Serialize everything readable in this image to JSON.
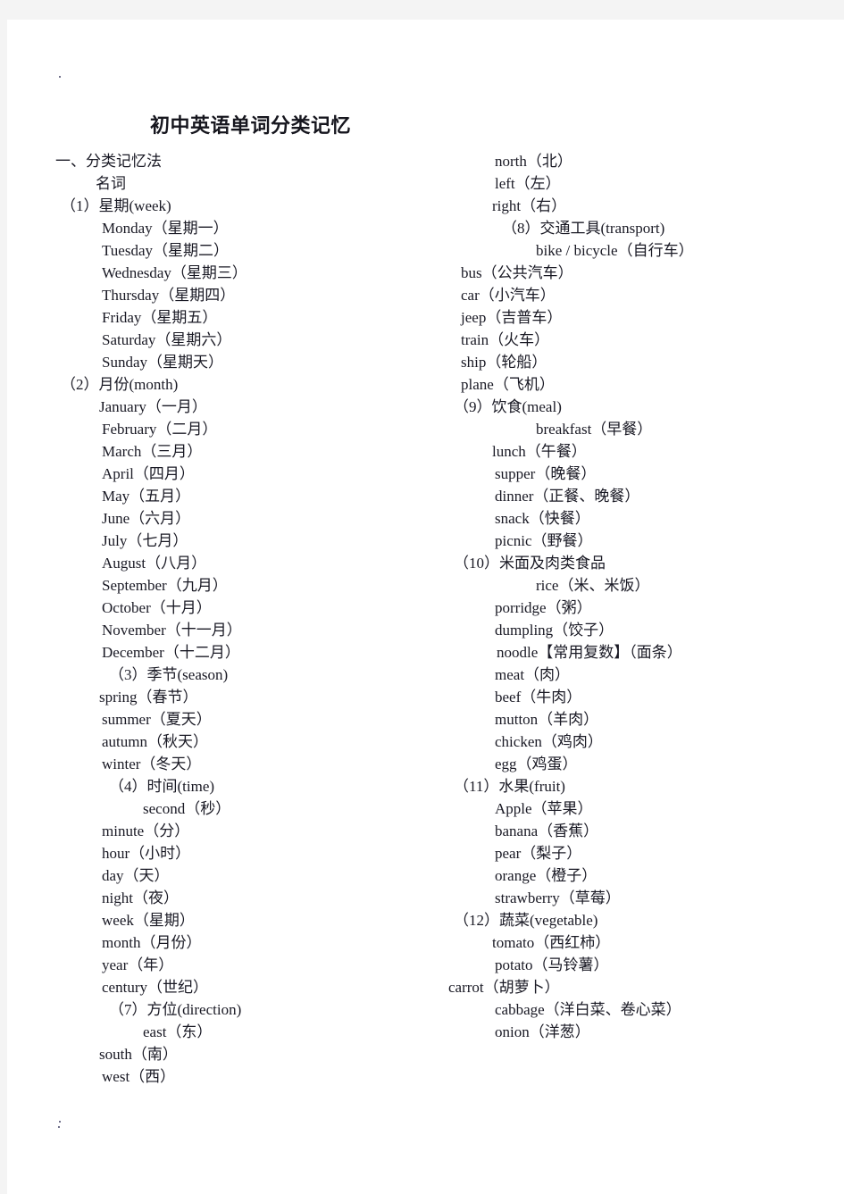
{
  "document": {
    "title": "初中英语单词分类记忆",
    "section_heading": "一、分类记忆法",
    "subheading": "名词"
  },
  "left_column": [
    {
      "text": "一、分类记忆法",
      "indent": "i0",
      "kind": "heading"
    },
    {
      "text": "名词",
      "indent": "i3",
      "kind": "subheading"
    },
    {
      "text": "（1）星期(week)",
      "indent": "i1",
      "kind": "group"
    },
    {
      "text": "Monday（星期一）",
      "indent": "i5",
      "kind": "entry"
    },
    {
      "text": "Tuesday（星期二）",
      "indent": "i5",
      "kind": "entry"
    },
    {
      "text": "Wednesday（星期三）",
      "indent": "i5",
      "kind": "entry"
    },
    {
      "text": "Thursday（星期四）",
      "indent": "i5",
      "kind": "entry"
    },
    {
      "text": "Friday（星期五）",
      "indent": "i5",
      "kind": "entry"
    },
    {
      "text": "Saturday（星期六）",
      "indent": "i5",
      "kind": "entry"
    },
    {
      "text": "Sunday（星期天）",
      "indent": "i5",
      "kind": "entry"
    },
    {
      "text": "（2）月份(month)",
      "indent": "i1",
      "kind": "group"
    },
    {
      "text": "January（一月）",
      "indent": "i4",
      "kind": "entry"
    },
    {
      "text": "February（二月）",
      "indent": "i5",
      "kind": "entry"
    },
    {
      "text": "March（三月）",
      "indent": "i5",
      "kind": "entry"
    },
    {
      "text": "April（四月）",
      "indent": "i5",
      "kind": "entry"
    },
    {
      "text": "May（五月）",
      "indent": "i5",
      "kind": "entry"
    },
    {
      "text": "June（六月）",
      "indent": "i5",
      "kind": "entry"
    },
    {
      "text": "July（七月）",
      "indent": "i5",
      "kind": "entry"
    },
    {
      "text": "August（八月）",
      "indent": "i5",
      "kind": "entry"
    },
    {
      "text": "September（九月）",
      "indent": "i5",
      "kind": "entry"
    },
    {
      "text": "October（十月）",
      "indent": "i5",
      "kind": "entry"
    },
    {
      "text": "November（十一月）",
      "indent": "i5",
      "kind": "entry"
    },
    {
      "text": "December（十二月）",
      "indent": "i5",
      "kind": "entry"
    },
    {
      "text": "（3）季节(season)",
      "indent": "i7",
      "kind": "group"
    },
    {
      "text": "spring（春节）",
      "indent": "i4",
      "kind": "entry"
    },
    {
      "text": "summer（夏天）",
      "indent": "i5",
      "kind": "entry"
    },
    {
      "text": "autumn（秋天）",
      "indent": "i5",
      "kind": "entry"
    },
    {
      "text": "winter（冬天）",
      "indent": "i5",
      "kind": "entry"
    },
    {
      "text": "（4）时间(time)",
      "indent": "i7",
      "kind": "group"
    },
    {
      "text": "second（秒）",
      "indent": "i9",
      "kind": "entry"
    },
    {
      "text": "minute（分）",
      "indent": "i5",
      "kind": "entry"
    },
    {
      "text": "hour（小时）",
      "indent": "i5",
      "kind": "entry"
    },
    {
      "text": "day（天）",
      "indent": "i5",
      "kind": "entry"
    },
    {
      "text": "night（夜）",
      "indent": "i5",
      "kind": "entry"
    },
    {
      "text": "week（星期）",
      "indent": "i5",
      "kind": "entry"
    },
    {
      "text": "month（月份）",
      "indent": "i5",
      "kind": "entry"
    },
    {
      "text": "year（年）",
      "indent": "i5",
      "kind": "entry"
    },
    {
      "text": "century（世纪）",
      "indent": "i5",
      "kind": "entry"
    },
    {
      "text": "（7）方位(direction)",
      "indent": "i7",
      "kind": "group"
    },
    {
      "text": "east（东）",
      "indent": "i9",
      "kind": "entry"
    },
    {
      "text": "south（南）",
      "indent": "i4",
      "kind": "entry"
    },
    {
      "text": "west（西）",
      "indent": "i5",
      "kind": "entry"
    }
  ],
  "right_column": [
    {
      "text": "north（北）",
      "indent": "i5",
      "kind": "entry"
    },
    {
      "text": "left（左）",
      "indent": "i5",
      "kind": "entry"
    },
    {
      "text": "right（右）",
      "indent": "i4",
      "kind": "entry"
    },
    {
      "text": "（8）交通工具(transport)",
      "indent": "i7",
      "kind": "group"
    },
    {
      "text": "bike / bicycle（自行车）",
      "indent": "i9",
      "kind": "entry"
    },
    {
      "text": "bus（公共汽车）",
      "indent": "i2",
      "kind": "entry"
    },
    {
      "text": "car（小汽车）",
      "indent": "i2",
      "kind": "entry"
    },
    {
      "text": "jeep（吉普车）",
      "indent": "i2",
      "kind": "entry"
    },
    {
      "text": "train（火车）",
      "indent": "i2",
      "kind": "entry"
    },
    {
      "text": "ship（轮船）",
      "indent": "i2",
      "kind": "entry"
    },
    {
      "text": "plane（飞机）",
      "indent": "i2",
      "kind": "entry"
    },
    {
      "text": "（9）饮食(meal)",
      "indent": "i1",
      "kind": "group"
    },
    {
      "text": "breakfast（早餐）",
      "indent": "i9",
      "kind": "entry"
    },
    {
      "text": "lunch（午餐）",
      "indent": "i4",
      "kind": "entry"
    },
    {
      "text": "supper（晚餐）",
      "indent": "i5",
      "kind": "entry"
    },
    {
      "text": "dinner（正餐、晚餐）",
      "indent": "i5",
      "kind": "entry"
    },
    {
      "text": "snack（快餐）",
      "indent": "i5",
      "kind": "entry"
    },
    {
      "text": "picnic（野餐）",
      "indent": "i5",
      "kind": "entry"
    },
    {
      "text": "（10）米面及肉类食品",
      "indent": "i1",
      "kind": "group"
    },
    {
      "text": "rice（米、米饭）",
      "indent": "i9",
      "kind": "entry"
    },
    {
      "text": "porridge（粥）",
      "indent": "i5",
      "kind": "entry"
    },
    {
      "text": "dumpling（饺子）",
      "indent": "i5",
      "kind": "entry"
    },
    {
      "text": "noodle【常用复数】（面条）",
      "indent": "i6",
      "kind": "entry"
    },
    {
      "text": "meat（肉）",
      "indent": "i5",
      "kind": "entry"
    },
    {
      "text": "beef（牛肉）",
      "indent": "i5",
      "kind": "entry"
    },
    {
      "text": "mutton（羊肉）",
      "indent": "i5",
      "kind": "entry"
    },
    {
      "text": "chicken（鸡肉）",
      "indent": "i5",
      "kind": "entry"
    },
    {
      "text": "egg（鸡蛋）",
      "indent": "i5",
      "kind": "entry"
    },
    {
      "text": "（11）水果(fruit)",
      "indent": "i1",
      "kind": "group"
    },
    {
      "text": "Apple（苹果）",
      "indent": "i5",
      "kind": "entry"
    },
    {
      "text": "banana（香蕉）",
      "indent": "i5",
      "kind": "entry"
    },
    {
      "text": "pear（梨子）",
      "indent": "i5",
      "kind": "entry"
    },
    {
      "text": "orange（橙子）",
      "indent": "i5",
      "kind": "entry"
    },
    {
      "text": "strawberry（草莓）",
      "indent": "i5",
      "kind": "entry"
    },
    {
      "text": "（12）蔬菜(vegetable)",
      "indent": "i1",
      "kind": "group"
    },
    {
      "text": "tomato（西红柿）",
      "indent": "i4",
      "kind": "entry"
    },
    {
      "text": "potato（马铃薯）",
      "indent": "i5",
      "kind": "entry"
    },
    {
      "text": "carrot（胡萝卜）",
      "indent": "i0",
      "kind": "entry"
    },
    {
      "text": "cabbage（洋白菜、卷心菜）",
      "indent": "i5",
      "kind": "entry"
    },
    {
      "text": "onion（洋葱）",
      "indent": "i5",
      "kind": "entry"
    }
  ],
  "colors": {
    "page_background": "#ffffff",
    "canvas_background": "#f4f4f4",
    "text": "#191924"
  }
}
